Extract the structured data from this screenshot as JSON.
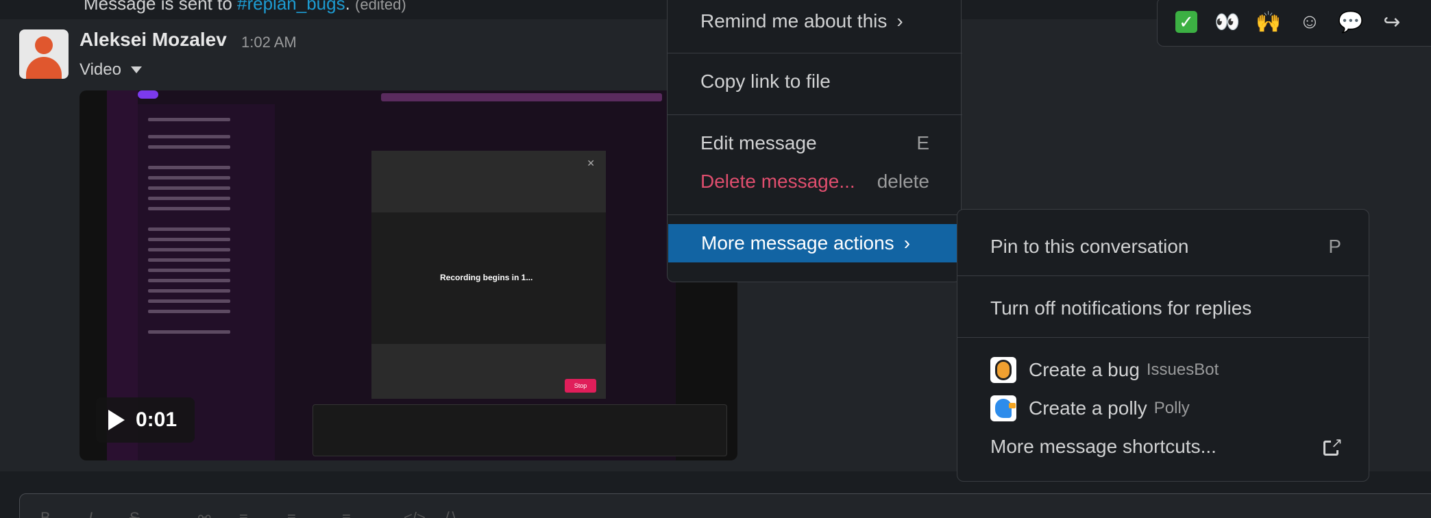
{
  "previous_message": {
    "text_prefix": "Message is sent to ",
    "channel": "#replan_bugs",
    "text_suffix": ".",
    "edited": "(edited)"
  },
  "message": {
    "author": "Aleksei Mozalev",
    "time": "1:02 AM",
    "file_label": "Video",
    "video": {
      "duration": "0:01",
      "recording_text": "Recording begins in 1...",
      "stop_label": "Stop"
    }
  },
  "reactions": {
    "items": [
      {
        "name": "white-check-mark",
        "glyph": "✓"
      },
      {
        "name": "eyes",
        "glyph": "👀"
      },
      {
        "name": "raised-hands",
        "glyph": "🙌"
      },
      {
        "name": "add-reaction",
        "glyph": "☺"
      },
      {
        "name": "reply-in-thread",
        "glyph": "💬"
      },
      {
        "name": "share",
        "glyph": "↪"
      }
    ]
  },
  "menu": {
    "remind": "Remind me about this",
    "copy_link": "Copy link to file",
    "edit": "Edit message",
    "edit_shortcut": "E",
    "delete": "Delete message...",
    "delete_shortcut": "delete",
    "more_actions": "More message actions",
    "chevron": "›"
  },
  "submenu": {
    "pin": "Pin to this conversation",
    "pin_shortcut": "P",
    "turn_off_notifications": "Turn off notifications for replies",
    "create_bug": "Create a bug",
    "create_bug_app": "IssuesBot",
    "create_polly": "Create a polly",
    "create_polly_app": "Polly",
    "more_shortcuts": "More message shortcuts..."
  },
  "colors": {
    "accent": "#1264a3",
    "danger": "#e04e6e",
    "link": "#1d9bd1",
    "background": "#1a1d21"
  }
}
